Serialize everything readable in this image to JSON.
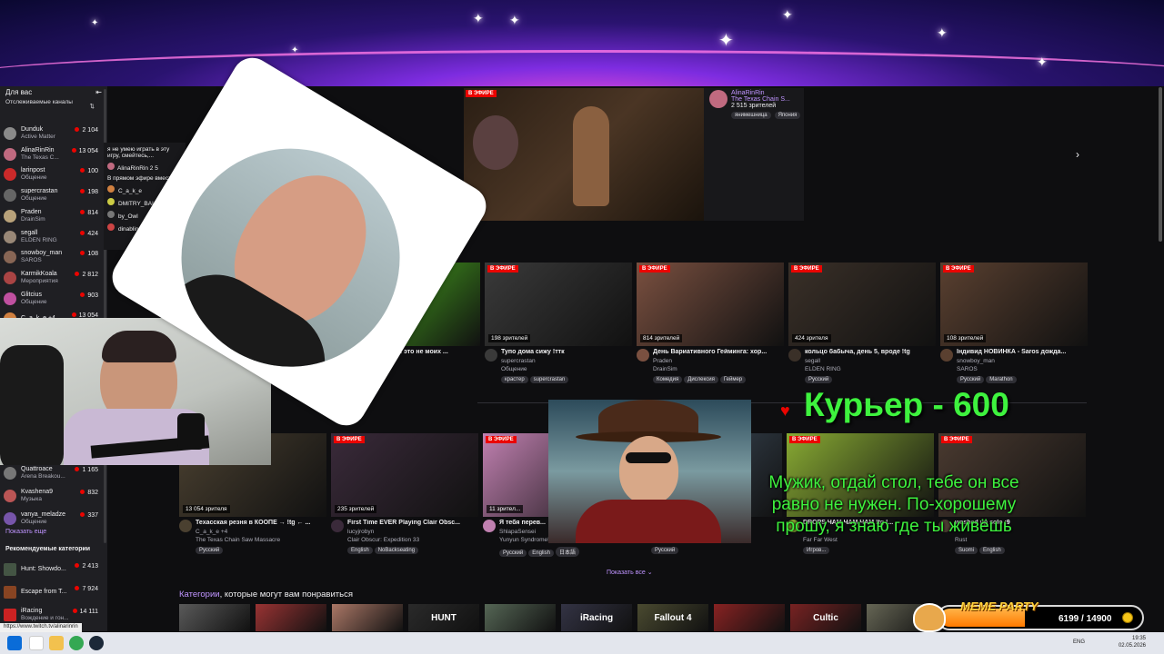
{
  "sidebar": {
    "for_you": "Для вас",
    "followed_title": "Отслеживаемые каналы",
    "channels": [
      {
        "name": "Dunduk",
        "game": "Active Matter",
        "viewers": "2 104",
        "color": "#8a8a8a"
      },
      {
        "name": "AlinaRinRin",
        "game": "The Texas C...",
        "viewers": "13 054",
        "color": "#c06a80"
      },
      {
        "name": "larinpost",
        "game": "Общение",
        "viewers": "100",
        "color": "#cc2a2a"
      },
      {
        "name": "supercrastan",
        "game": "Общение",
        "viewers": "198",
        "color": "#666"
      },
      {
        "name": "Praden",
        "game": "DrainSim",
        "viewers": "814",
        "color": "#b9a27a"
      },
      {
        "name": "segall",
        "game": "ELDEN RING",
        "viewers": "424",
        "color": "#998877"
      },
      {
        "name": "snowboy_man",
        "game": "SAROS",
        "viewers": "108",
        "color": "#886655"
      },
      {
        "name": "KarmikKoala",
        "game": "Мероприятия",
        "viewers": "2 812",
        "color": "#aa4444"
      },
      {
        "name": "Glitcius",
        "game": "Общение",
        "viewers": "903",
        "color": "#c050a0"
      },
      {
        "name": "C_a_k_e +4",
        "game": "",
        "viewers": "13 054",
        "color": "#d08040"
      }
    ],
    "channels_lower": [
      {
        "name": "Quattroace",
        "game": "Arena Breakou...",
        "viewers": "1 165",
        "color": "#777"
      },
      {
        "name": "Kvashena9",
        "game": "Музыка",
        "viewers": "832",
        "color": "#bb5555"
      },
      {
        "name": "vanya_meladze",
        "game": "Общение",
        "viewers": "337",
        "color": "#7755aa"
      }
    ],
    "show_more": "Показать еще",
    "recommended_title": "Рекомендуемые категории",
    "categories": [
      {
        "name": "Hunt: Showdo...",
        "viewers": "2 413",
        "color": "#445544"
      },
      {
        "name": "Escape from T...",
        "viewers": "7 924",
        "color": "#884422"
      },
      {
        "name": "iRacing",
        "game": "Вождение и гон...",
        "viewers": "14 111",
        "color": "#cc2222"
      }
    ]
  },
  "popup": {
    "text": "я не умею играть в эту игру, смейтесь,...",
    "host": "AlinaRinRin",
    "host_viewers": "2 5",
    "in_live": "В прямом эфире вмест",
    "others": [
      "C_a_k_e",
      "DMITRY_BALE",
      "by_Owl",
      "dinablin"
    ]
  },
  "featured": {
    "live": "В ЭФИРЕ",
    "channel": "AlinaRinRin",
    "game": "The Texas Chain S...",
    "viewers": "2 515 зрителей",
    "tags": [
      "янимешница",
      "Япония"
    ]
  },
  "row1": [
    {
      "title": "...крутило ботов. это не моих ...",
      "channel": "...ost",
      "game": "...",
      "tags": [
        "Русский"
      ],
      "viewers": "",
      "color": "#55cc22"
    },
    {
      "title": "Тупо дома сижу !ттк",
      "channel": "supercrastan",
      "game": "Общение",
      "tags": [
        "крастер",
        "supercrastan"
      ],
      "viewers": "198 зрителей",
      "color": "#3a3a3a"
    },
    {
      "title": "День Вариативного Гейминга: хор...",
      "channel": "Praden",
      "game": "DrainSim",
      "tags": [
        "Комедия",
        "Дислексия",
        "Геймер"
      ],
      "viewers": "814 зрителей",
      "color": "#7a5040"
    },
    {
      "title": "кольцо бабыча, день 5, вроде !tg",
      "channel": "segall",
      "game": "ELDEN RING",
      "tags": [
        "Русский"
      ],
      "viewers": "424 зрителя",
      "color": "#3a3028"
    },
    {
      "title": "Інди​вид НОВИНКА - Saros дожда...",
      "channel": "snowboy_man",
      "game": "SAROS",
      "tags": [
        "Русский",
        "Marathon"
      ],
      "viewers": "108 зрителей",
      "color": "#5a4030"
    }
  ],
  "row2": [
    {
      "title": "Техасская резня в КООПЕ → !tg ← ...",
      "channel": "C_a_k_e +4",
      "game": "The Texas Chain Saw Massacre",
      "tags": [
        "Русский"
      ],
      "viewers": "13 054 зрителя",
      "color": "#4a4030"
    },
    {
      "title": "First Time EVER Playing Clair Obsc...",
      "channel": "lucyjrobyn",
      "game": "Clair Obscur: Expedition 33",
      "tags": [
        "English",
        "NoBackseating"
      ],
      "viewers": "235 зрителей",
      "color": "#3a2a3a"
    },
    {
      "title": "Я тебя перев...",
      "channel": "ShlapaSensei",
      "game": "Yunyun Syndrome!?",
      "tags": [
        "Русский",
        "English",
        "日本語"
      ],
      "viewers": "11 зрител...",
      "color": "#c080b0"
    },
    {
      "title": "...ИИ",
      "channel": "",
      "game": "...",
      "tags": [
        "Русский"
      ],
      "viewers": "",
      "color": "#445566"
    },
    {
      "title": "DROPS ЧАМ ЧАМ ЧАМ !tg !...",
      "channel": "",
      "game": "Far Far West",
      "tags": [
        "Игров..."
      ],
      "viewers": "",
      "color": "#88aa33"
    },
    {
      "title": "washed up solo :9",
      "channel": "",
      "game": "Rust",
      "tags": [
        "Suomi",
        "English"
      ],
      "viewers": "",
      "color": "#4a3a30"
    }
  ],
  "live_label": "В ЭФИРЕ",
  "show_all": "Показать все",
  "categories_title_hl": "Категории",
  "categories_title_rest": ", которые могут вам понравиться",
  "category_tiles": [
    {
      "label": "",
      "color": "#5a5a5a"
    },
    {
      "label": "",
      "color": "#993333"
    },
    {
      "label": "",
      "color": "#aa7766"
    },
    {
      "label": "HUNT",
      "color": "#2a2a2a"
    },
    {
      "label": "",
      "color": "#556655"
    },
    {
      "label": "iRacing",
      "color": "#333344"
    },
    {
      "label": "Fallout 4",
      "color": "#4a4a30"
    },
    {
      "label": "",
      "color": "#882222"
    },
    {
      "label": "Cultic",
      "color": "#772222"
    },
    {
      "label": "",
      "color": "#666655"
    }
  ],
  "overlay": {
    "courier": "Курьер - 600",
    "message": "Мужик, отдай стол, тебе он все равно не нужен. По-хорошему прошу, я знаю где ты живёшь"
  },
  "meme": {
    "title": "MEME PARTY",
    "count": "6199 / 14900",
    "progress": 0.416
  },
  "status_url": "https://www.twitch.tv/alinarinrin",
  "taskbar": {
    "lang": "ENG",
    "time": "19:35",
    "date": "02.05.2026"
  }
}
